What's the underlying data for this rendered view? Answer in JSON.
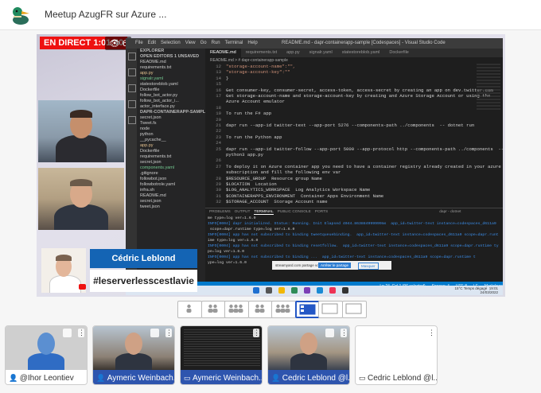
{
  "header": {
    "meeting_title": "Meetup AzugFR sur Azure ..."
  },
  "stream": {
    "live_label": "EN DIRECT 1:01:40",
    "viewer_count": "6",
    "editor": {
      "menu": [
        "File",
        "Edit",
        "Selection",
        "View",
        "Go",
        "Run",
        "Terminal",
        "Help"
      ],
      "window_title": "README.md - dapr-containerapp-sample [Codespaces] - Visual Studio Code",
      "explorer_lines": [
        {
          "t": "EXPLORER",
          "c": "hd"
        },
        {
          "t": "OPEN EDITORS  1 UNSAVED",
          "c": "hd"
        },
        {
          "t": "  README.md",
          "c": ""
        },
        {
          "t": "  requirements.txt",
          "c": ""
        },
        {
          "t": "  app.py",
          "c": "y"
        },
        {
          "t": "  signalr.yaml",
          "c": "g"
        },
        {
          "t": "  statestoreblob.yaml",
          "c": ""
        },
        {
          "t": "  Dockerfile",
          "c": ""
        },
        {
          "t": "  follow_bot_actor.py",
          "c": ""
        },
        {
          "t": "  follow_bot_actor_i...",
          "c": ""
        },
        {
          "t": "  actor_interface.py",
          "c": ""
        },
        {
          "t": "DAPR-CONTAINERAPP-SAMPLE (C...",
          "c": "hd"
        },
        {
          "t": "  secret.json",
          "c": ""
        },
        {
          "t": "  Tweet.fs",
          "c": ""
        },
        {
          "t": "  node",
          "c": ""
        },
        {
          "t": "  python",
          "c": ""
        },
        {
          "t": "    __pycache__",
          "c": ""
        },
        {
          "t": "  app.py",
          "c": "y"
        },
        {
          "t": "  Dockerfile",
          "c": ""
        },
        {
          "t": "  requirements.txt",
          "c": ""
        },
        {
          "t": "  secret.json",
          "c": ""
        },
        {
          "t": "  components.yaml",
          "c": "g"
        },
        {
          "t": "  .gitignore",
          "c": ""
        },
        {
          "t": "  followbot.json",
          "c": ""
        },
        {
          "t": "  followbotrole.yaml",
          "c": ""
        },
        {
          "t": "  infra.sh",
          "c": ""
        },
        {
          "t": "  README.md",
          "c": ""
        },
        {
          "t": "  secret.json",
          "c": ""
        },
        {
          "t": "  tweet.json",
          "c": ""
        }
      ],
      "tabs": [
        {
          "label": "README.md",
          "active": true
        },
        {
          "label": "requirements.txt",
          "active": false
        },
        {
          "label": "app.py",
          "active": false
        },
        {
          "label": "signalr.yaml",
          "active": false
        },
        {
          "label": "statestoreblob.yaml",
          "active": false
        },
        {
          "label": "Dockerfile",
          "active": false
        }
      ],
      "breadcrumb": "README.md > # dapr-containerapp-sample",
      "code_lines": [
        {
          "n": "12",
          "t": "\"storage-account-name\":\"\",",
          "c": "str"
        },
        {
          "n": "13",
          "t": "\"storage-account-key\":\"\"",
          "c": "str"
        },
        {
          "n": "14",
          "t": "}",
          "c": ""
        },
        {
          "n": "15",
          "t": "",
          "c": ""
        },
        {
          "n": "16",
          "t": "Get consumer-key, consumer-secret, access-token, access-secret by creating an app on dev.twitter.com",
          "c": ""
        },
        {
          "n": "17",
          "t": "Get storage-account-name and storage-account-key by creating and Azure Storage Account or using the",
          "c": ""
        },
        {
          "n": "",
          "t": "Azure Account emulator",
          "c": ""
        },
        {
          "n": "18",
          "t": "",
          "c": ""
        },
        {
          "n": "19",
          "t": "To run the F# app",
          "c": ""
        },
        {
          "n": "20",
          "t": "",
          "c": ""
        },
        {
          "n": "21",
          "t": "dapr run --app-id twitter-text --app-port 5276 --components-path ../components  -- dotnet run",
          "c": ""
        },
        {
          "n": "22",
          "t": "",
          "c": ""
        },
        {
          "n": "23",
          "t": "To run the Python app",
          "c": ""
        },
        {
          "n": "24",
          "t": "",
          "c": ""
        },
        {
          "n": "25",
          "t": "dapr run --app-id twitter-follow --app-port 5000 --app-protocol http --components-path ../components  --",
          "c": ""
        },
        {
          "n": "",
          "t": "python3 app.py",
          "c": ""
        },
        {
          "n": "26",
          "t": "",
          "c": ""
        },
        {
          "n": "27",
          "t": "To deploy it on Azure container app you need to have a container registry already created in your azure",
          "c": ""
        },
        {
          "n": "",
          "t": "subscription and fill the following env var",
          "c": ""
        },
        {
          "n": "28",
          "t": "$RESOURCE_GROUP  Resource group Name",
          "c": ""
        },
        {
          "n": "29",
          "t": "$LOCATION  Location",
          "c": ""
        },
        {
          "n": "30",
          "t": "$LOG_ANALYTICS_WORKSPACE  Log Analytics Workspace Name",
          "c": ""
        },
        {
          "n": "31",
          "t": "$CONTAINERAPPS_ENVIRONMENT  Container Apps Environment Name",
          "c": ""
        },
        {
          "n": "32",
          "t": "$STORAGE_ACCOUNT  Storage Account name",
          "c": ""
        }
      ],
      "terminal_tabs": [
        "PROBLEMS",
        "OUTPUT",
        "TERMINAL",
        "PUBLIC CONSOLE",
        "PORTS"
      ],
      "terminal_active": "TERMINAL",
      "terminal_process": "dapr - dotnet",
      "terminal_lines": [
        {
          "t": "me type=log ver=1.6.0",
          "c": ""
        },
        {
          "t": "INFO[0004] dapr initialized. Status: Running. Init Elapsed 4044.863884999999ms  app_id=twitter-text instance=codespaces_d611a9",
          "c": "info"
        },
        {
          "t": " scope=dapr.runtime type=log ver=1.6.0",
          "c": ""
        },
        {
          "t": "INFO[0004] app has not subscribed to binding tweetqueuebinding.  app_id=twitter-text instance=codespaces_d611a9 scope=dapr.runt",
          "c": "info"
        },
        {
          "t": "ime type=log ver=1.6.0",
          "c": ""
        },
        {
          "t": "INFO[0004] app has not subscribed to binding resetfollow.  app_id=twitter-text instance=codespaces_d611a9 scope=dapr.runtime ty",
          "c": "info"
        },
        {
          "t": "pe=log ver=1.6.0",
          "c": ""
        },
        {
          "t": "INFO[0004] app has not subscribed to binding ...  app_id=twitter-text instance=codespaces_d611a9 scope=dapr.runtime t",
          "c": "info"
        },
        {
          "t": "ype=log ver=1.6.0",
          "c": ""
        }
      ],
      "share_notice": {
        "text": "streamyard.com partage votre écran.",
        "stop_label": "Arrêter le partage",
        "hide_label": "Masquer"
      },
      "status_bar": [
        "Ln 24, Col 1 (96 selected)",
        "Spaces: 4",
        "UTF-8",
        "LF",
        "Markdown"
      ],
      "taskbar": {
        "weather": "15°C  Temps dégagé",
        "time": "19:01",
        "date": "24/03/2022"
      }
    },
    "lower_third": {
      "name": "Cédric Leblond",
      "hashtag": "#leserverlesscestlavie"
    }
  },
  "layout_options": [
    "single",
    "group",
    "leader",
    "group-wide",
    "group-plus",
    "screen-share-active",
    "screen-share",
    "screen-share-wide"
  ],
  "layout_active_index": 5,
  "participants": [
    {
      "name": "@Ihor Leontiev",
      "kind": "camera",
      "on_air": false
    },
    {
      "name": "Aymeric Weinbach...",
      "kind": "camera",
      "on_air": true
    },
    {
      "name": "Aymeric Weinbach...",
      "kind": "screen",
      "on_air": true
    },
    {
      "name": "Cedric Leblond @l...",
      "kind": "camera",
      "on_air": true
    },
    {
      "name": "Cedric Leblond @l...",
      "kind": "screen",
      "on_air": false
    }
  ],
  "colors": {
    "live_red": "#ee1111",
    "brand_blue": "#1464b4",
    "tile_label_blue": "#2e55ae",
    "vscode_status": "#007acc"
  }
}
